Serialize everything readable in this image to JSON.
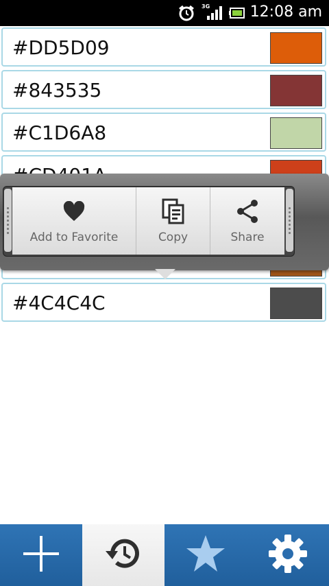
{
  "status_bar": {
    "time": "12:08 am",
    "network": "3G",
    "icons": [
      "alarm-icon",
      "signal-icon",
      "battery-icon"
    ]
  },
  "colors": [
    {
      "hex": "#DD5D09",
      "swatch": "#DD5D09"
    },
    {
      "hex": "#843535",
      "swatch": "#843535"
    },
    {
      "hex": "#C1D6A8",
      "swatch": "#C1D6A8"
    },
    {
      "hex": "#CD401A",
      "swatch": "#CD401A"
    },
    {
      "hex": "",
      "swatch": "#A0561A"
    },
    {
      "hex": "#4C4C4C",
      "swatch": "#4C4C4C"
    }
  ],
  "popup": {
    "actions": [
      {
        "label": "Add to Favorite",
        "icon": "heart-icon"
      },
      {
        "label": "Copy",
        "icon": "copy-icon"
      },
      {
        "label": "Share",
        "icon": "share-icon"
      }
    ]
  },
  "tabs": [
    {
      "name": "add",
      "icon": "plus-icon",
      "active": false
    },
    {
      "name": "history",
      "icon": "history-icon",
      "active": true
    },
    {
      "name": "favorites",
      "icon": "star-icon",
      "active": false
    },
    {
      "name": "settings",
      "icon": "gear-icon",
      "active": false
    }
  ],
  "theme": {
    "tab_blue": "#2A6DAE",
    "row_border": "#A9D8E6"
  }
}
